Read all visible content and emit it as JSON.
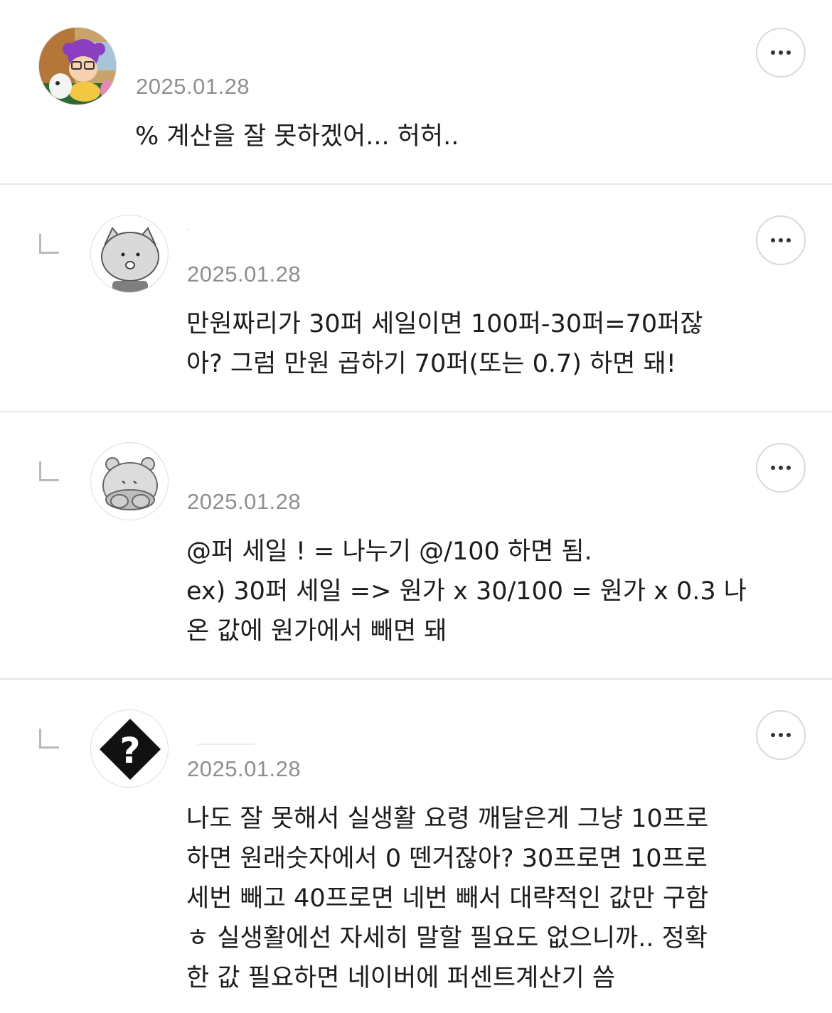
{
  "comments": [
    {
      "date": "2025.01.28",
      "text": "% 계산을 잘 못하겠어... 허허..",
      "avatar_icon": "cartoon-girl-avatar-icon"
    },
    {
      "date": "2025.01.28",
      "text": "만원짜리가 30퍼 세일이면 100퍼-30퍼=70퍼잖\n아? 그럼 만원 곱하기 70퍼(또는 0.7) 하면 돼!",
      "avatar_icon": "gray-cat-avatar-icon"
    },
    {
      "date": "2025.01.28",
      "text": "@퍼 세일 ! = 나누기 @/100 하면 됨.\nex) 30퍼 세일 => 원가 x 30/100 = 원가 x 0.3 나\n온 값에 원가에서 빼면 돼",
      "avatar_icon": "gray-bear-avatar-icon"
    },
    {
      "date": "2025.01.28",
      "text": "나도 잘 못해서 실생활 요령 깨달은게 그냥 10프로\n하면 원래숫자에서 0 뗀거잖아? 30프로면 10프로\n세번 빼고 40프로면 네번 빼서 대략적인 값만 구함\nㅎ 실생활에선 자세히 말할 필요도 없으니까.. 정확\n한 값 필요하면 네이버에 퍼센트계산기 씀",
      "avatar_icon": "question-mark-diamond-icon"
    }
  ],
  "colors": {
    "date": "#8e8e93",
    "divider": "#e6e6e6",
    "text": "#1c1c1c"
  }
}
